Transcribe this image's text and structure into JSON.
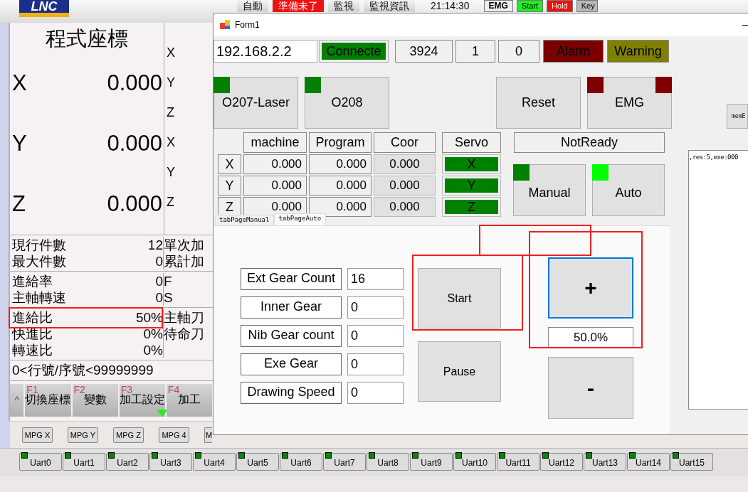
{
  "app": {
    "logo": "LNC",
    "top_bar": [
      {
        "label": "自動",
        "kind": "plain"
      },
      {
        "label": "準備未了",
        "kind": "alert"
      },
      {
        "label": "監視",
        "kind": "plain"
      },
      {
        "label": "監視資訊",
        "kind": "plain"
      },
      {
        "label": "21:14:30",
        "kind": "clock"
      }
    ],
    "indicators": [
      {
        "label": "EMG",
        "kind": "emg"
      },
      {
        "label": "Start",
        "kind": "start"
      },
      {
        "label": "Hold",
        "kind": "hold"
      },
      {
        "label": "Key",
        "kind": "key"
      }
    ],
    "coordinates": {
      "title": "程式座標",
      "axes": [
        {
          "axis": "X",
          "value": "0.000"
        },
        {
          "axis": "Y",
          "value": "0.000"
        },
        {
          "axis": "Z",
          "value": "0.000"
        }
      ],
      "side_axes": [
        "X",
        "Y",
        "Z",
        "X",
        "Y",
        "Z"
      ]
    },
    "info_groups": [
      [
        {
          "label": "現行件數",
          "value": "12",
          "side": "單次加"
        },
        {
          "label": "最大件數",
          "value": "0",
          "side": "累計加"
        }
      ],
      [
        {
          "label": "進給率",
          "value": "0",
          "side": "F"
        },
        {
          "label": "主軸轉速",
          "value": "0",
          "side": "S"
        }
      ],
      [
        {
          "label": "進給比",
          "value": "50%",
          "side": "主軸刀"
        },
        {
          "label": "快進比",
          "value": "0%",
          "side": "待命刀"
        },
        {
          "label": "轉速比",
          "value": "0%"
        }
      ]
    ],
    "range_line": "0<行號/序號<99999999",
    "expand_key": "^",
    "function_keys": [
      {
        "key": "F1",
        "label": "切換座標",
        "marked": false
      },
      {
        "key": "F2",
        "label": "變數",
        "marked": false
      },
      {
        "key": "F3",
        "label": "加工設定",
        "marked": true
      },
      {
        "key": "F4",
        "label": "加工",
        "marked": false
      }
    ],
    "mpg_buttons": [
      "MPG X",
      "MPG Y",
      "MPG Z",
      "MPG 4",
      "M"
    ],
    "uart_buttons": [
      {
        "label": "Uart0",
        "on": true
      },
      {
        "label": "Uart1",
        "on": true
      },
      {
        "label": "Uart2",
        "on": true
      },
      {
        "label": "Uart3",
        "on": true
      },
      {
        "label": "Uart4",
        "on": true
      },
      {
        "label": "Uart5",
        "on": true
      },
      {
        "label": "Uart6",
        "on": true
      },
      {
        "label": "Uart7",
        "on": true
      },
      {
        "label": "Uart8",
        "on": true
      },
      {
        "label": "Uart9",
        "on": true
      },
      {
        "label": "Uart10",
        "on": true
      },
      {
        "label": "Uart11",
        "on": true
      },
      {
        "label": "Uart12",
        "on": true
      },
      {
        "label": "Uart13",
        "on": true
      },
      {
        "label": "Uart14",
        "on": true
      },
      {
        "label": "Uart15",
        "on": true
      }
    ]
  },
  "form": {
    "title": "Form1",
    "ip": "192.168.2.2",
    "connection": {
      "label": "Connecte",
      "connected": true
    },
    "counters": [
      "3924",
      "1",
      "0"
    ],
    "alarm": {
      "label": "Alarm",
      "lit": false
    },
    "warning": {
      "label": "Warning",
      "lit": false
    },
    "program_buttons": [
      {
        "label": "O207-Laser",
        "on": true
      },
      {
        "label": "O208",
        "on": true
      }
    ],
    "reset": "Reset",
    "emg": {
      "label": "EMG",
      "lit": false
    },
    "position_table": {
      "columns": [
        "machine",
        "Program",
        "Coor",
        "Servo"
      ],
      "rows": [
        {
          "axis": "X",
          "machine": "0.000",
          "program": "0.000",
          "coor": "0.000",
          "servo": "X",
          "servo_on": true
        },
        {
          "axis": "Y",
          "machine": "0.000",
          "program": "0.000",
          "coor": "0.000",
          "servo": "Y",
          "servo_on": true
        },
        {
          "axis": "Z",
          "machine": "0.000",
          "program": "0.000",
          "coor": "0.000",
          "servo": "Z",
          "servo_on": true
        }
      ]
    },
    "status": "NotReady",
    "modes": [
      {
        "label": "Manual",
        "selected": false
      },
      {
        "label": "Auto",
        "selected": true
      }
    ],
    "tabs": [
      {
        "label": "tabPageManual",
        "selected": false
      },
      {
        "label": "tabPageAuto",
        "selected": true
      }
    ],
    "gear_fields": [
      {
        "label": "Ext Gear Count",
        "value": "16"
      },
      {
        "label": "Inner Gear",
        "value": "0"
      },
      {
        "label": "Nib Gear count",
        "value": "0"
      },
      {
        "label": "Exe Gear",
        "value": "0"
      },
      {
        "label": "Drawing Speed",
        "value": "0"
      }
    ],
    "start": "Start",
    "pause": "Pause",
    "increase": "+",
    "ratio": "50.0%",
    "decrease": "-",
    "side": {
      "button": "memE",
      "log": ",res:5,exe:000"
    }
  }
}
